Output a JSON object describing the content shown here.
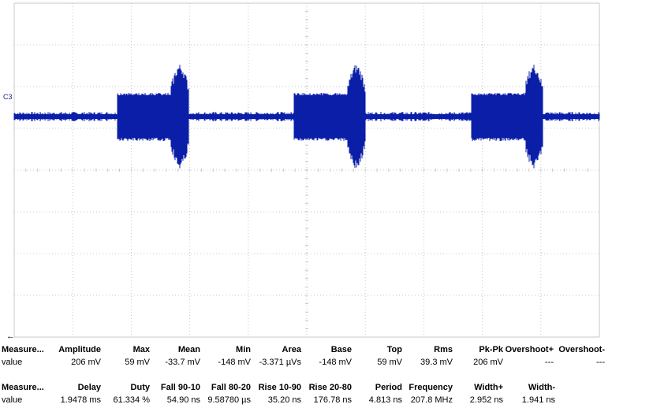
{
  "channel": {
    "label": "C3",
    "trace_color": "#0b1ea8",
    "grid_color": "#c8c8c8"
  },
  "waveform": {
    "bursts": 3,
    "description_visible": false
  },
  "measurements": {
    "table1": {
      "header_label": "Measure...",
      "value_label": "value",
      "columns": [
        "Amplitude",
        "Max",
        "Mean",
        "Min",
        "Area",
        "Base",
        "Top",
        "Rms",
        "Pk-Pk",
        "Overshoot+",
        "Overshoot-"
      ],
      "values": [
        "206 mV",
        "59 mV",
        "-33.7 mV",
        "-148 mV",
        "-3.371 µVs",
        "-148 mV",
        "59 mV",
        "39.3 mV",
        "206 mV",
        "---",
        "---"
      ]
    },
    "table2": {
      "header_label": "Measure...",
      "value_label": "value",
      "columns": [
        "Delay",
        "Duty",
        "Fall 90-10",
        "Fall 80-20",
        "Rise 10-90",
        "Rise 20-80",
        "Period",
        "Frequency",
        "Width+",
        "Width-"
      ],
      "values": [
        "1.9478 ms",
        "61.334 %",
        "54.90 ns",
        "9.58780 µs",
        "35.20 ns",
        "176.78 ns",
        "4.813 ns",
        "207.8 MHz",
        "2.952 ns",
        "1.941 ns"
      ]
    }
  },
  "scroll_arrow": "←"
}
